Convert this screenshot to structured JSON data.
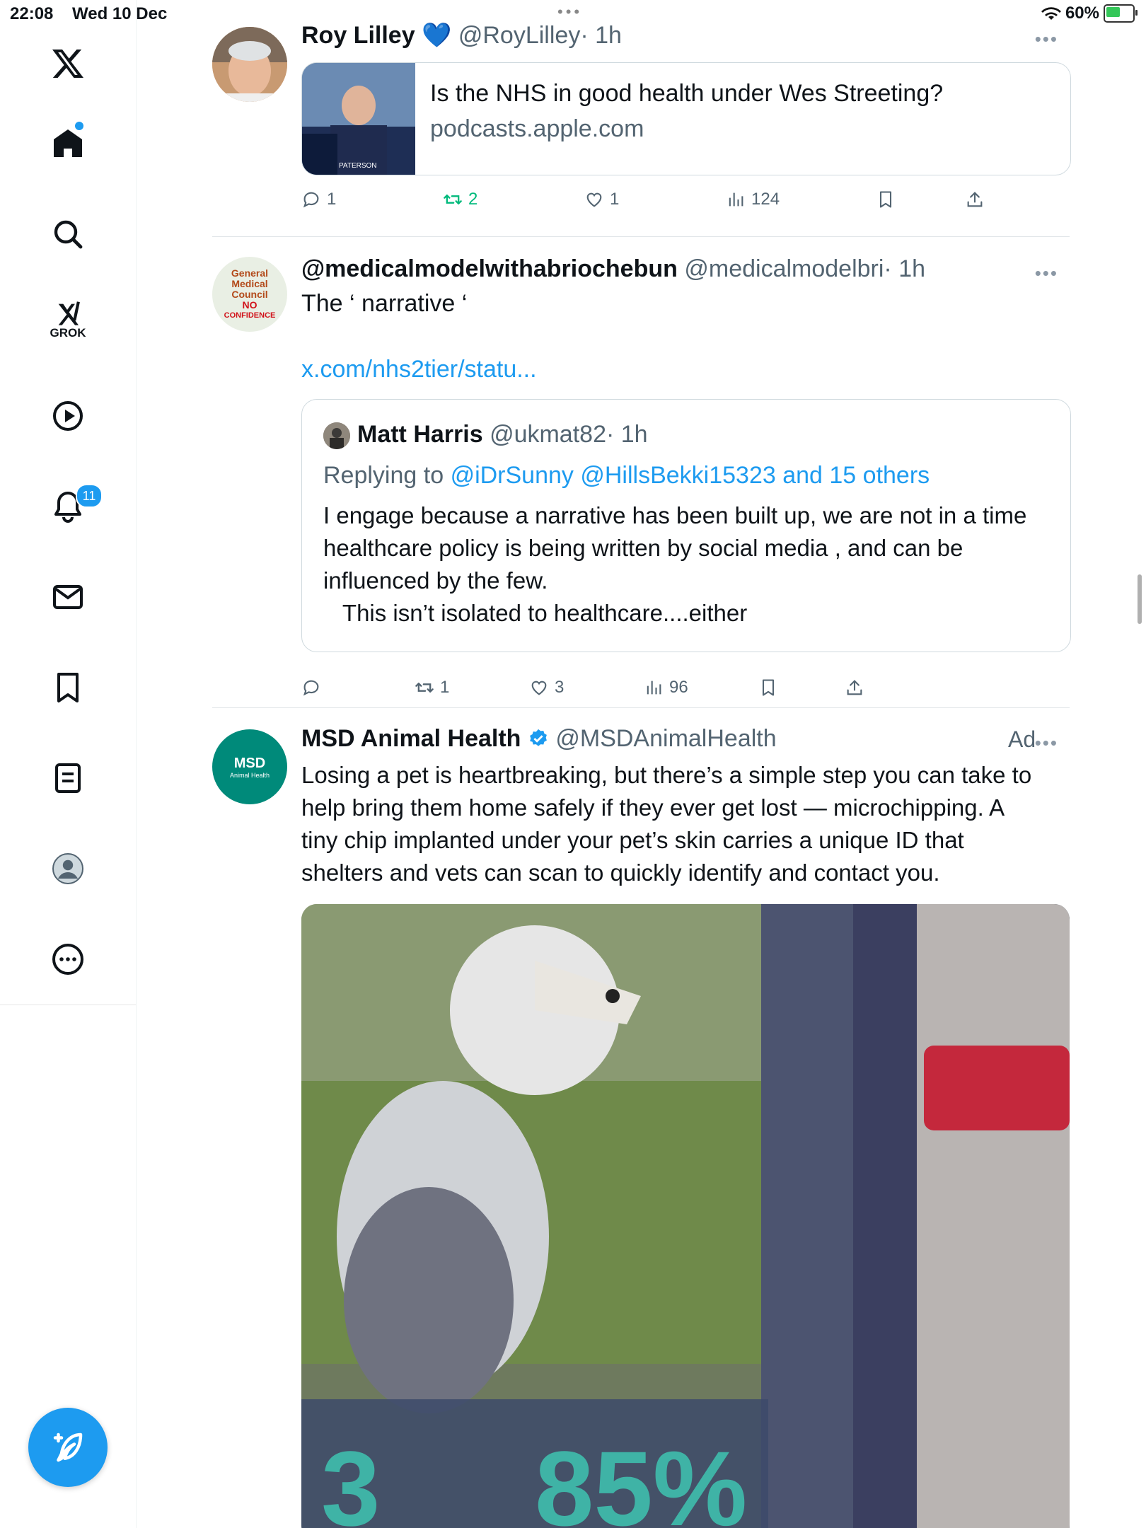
{
  "status_bar": {
    "time": "22:08",
    "date": "Wed 10 Dec",
    "battery": "60%",
    "battery_level": 0.6
  },
  "sidebar": {
    "items": [
      {
        "icon": "x-logo-icon"
      },
      {
        "icon": "home-icon"
      },
      {
        "icon": "search-icon"
      },
      {
        "icon": "grok-icon",
        "label": "GROK"
      },
      {
        "icon": "video-icon"
      },
      {
        "icon": "notifications-icon",
        "badge": "11"
      },
      {
        "icon": "messages-icon"
      },
      {
        "icon": "bookmarks-icon"
      },
      {
        "icon": "lists-icon"
      },
      {
        "icon": "profile-icon"
      },
      {
        "icon": "more-icon"
      }
    ],
    "compose_icon": "compose-icon"
  },
  "tweets": [
    {
      "name": "Roy Lilley",
      "emoji": "💙",
      "handle": "@RoyLilley",
      "time": "· 1h",
      "card": {
        "title": "Is the NHS in good health under Wes Streeting?",
        "domain": "podcasts.apple.com",
        "thumb_text": "PATERSON"
      },
      "actions": {
        "replies": "1",
        "retweets": "2",
        "likes": "1",
        "views": "124"
      }
    },
    {
      "name": "@medicalmodelwithabriochebun",
      "handle": "@medicalmodelbri",
      "time": "· 1h",
      "avatar_text": [
        "General",
        "Medical",
        "Council",
        "NO",
        "CONFIDENCE"
      ],
      "text": "The ‘ narrative ‘",
      "link": "x.com/nhs2tier/statu...",
      "quote": {
        "name": "Matt Harris",
        "handle": "@ukmat82",
        "time": "· 1h",
        "replying_prefix": "Replying to",
        "replying_to": "@iDrSunny @HillsBekki15323 and 15 others",
        "lines": [
          "I engage because a narrative has been built up, we are not in a time",
          "healthcare policy is being written by social media , and can be",
          "influenced by the few.",
          "   This isn’t isolated to healthcare....either"
        ]
      },
      "actions": {
        "replies": "",
        "retweets": "1",
        "likes": "3",
        "views": "96"
      }
    },
    {
      "name": "MSD Animal Health",
      "handle": "@MSDAnimalHealth",
      "ad_label": "Ad",
      "avatar_text": "MSD",
      "avatar_subtext": "Animal Health",
      "lines": [
        "Losing a pet is heartbreaking, but there’s a simple step you can take to",
        "help bring them home safely if they ever get lost — microchipping. A",
        "tiny chip implanted under your pet’s skin carries a unique ID that",
        "shelters and vets can scan to quickly identify and contact you."
      ],
      "media_overlay": {
        "left": "3",
        "right": "85%"
      }
    }
  ]
}
